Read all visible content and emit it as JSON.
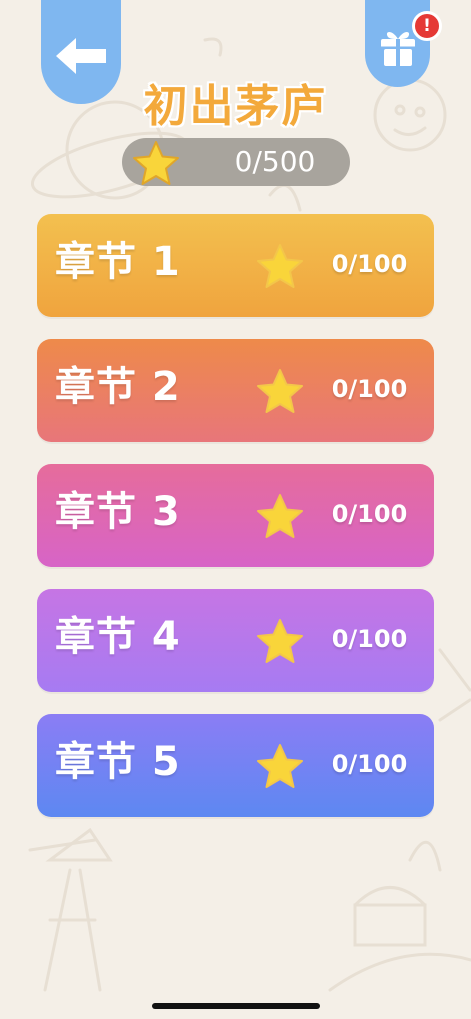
{
  "header": {
    "title": "初出茅庐",
    "back_icon": "back-arrow-icon",
    "gift_icon": "gift-icon",
    "alert_badge": "!"
  },
  "total": {
    "score": "0/500",
    "icon": "star-icon"
  },
  "chapters": [
    {
      "label": "章节 1",
      "score": "0/100",
      "color_top": "#f3c04f",
      "color_bottom": "#f0a43e"
    },
    {
      "label": "章节 2",
      "score": "0/100",
      "color_top": "#ee8a4a",
      "color_bottom": "#e8767a"
    },
    {
      "label": "章节 3",
      "score": "0/100",
      "color_top": "#e66c9b",
      "color_bottom": "#d764c7"
    },
    {
      "label": "章节 4",
      "score": "0/100",
      "color_top": "#c675e4",
      "color_bottom": "#a67bf2"
    },
    {
      "label": "章节 5",
      "score": "0/100",
      "color_top": "#8b7df4",
      "color_bottom": "#5d88f2"
    }
  ],
  "colors": {
    "tab_blue": "#7fb7f0",
    "title_orange": "#f3a93b",
    "star_yellow": "#f9d53a",
    "badge_red": "#e53935",
    "background": "#f4efe7"
  }
}
